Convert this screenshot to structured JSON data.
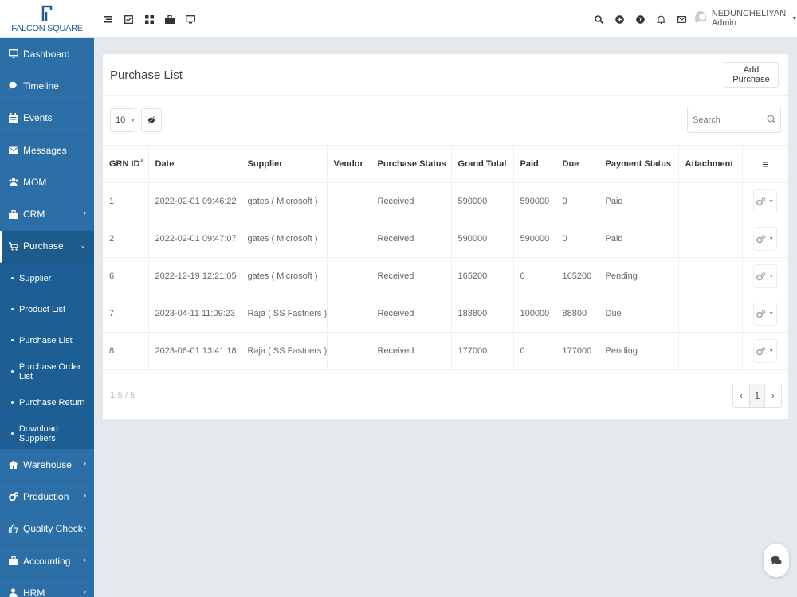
{
  "brand": {
    "logo_text": "FALCON SQUARE",
    "primary_color": "#2b6fa6",
    "logo_color": "#1f5f96"
  },
  "topbar": {
    "left_icons": [
      "list-icon",
      "checkbox-icon",
      "grid-icon",
      "briefcase-icon",
      "monitor-icon"
    ],
    "right_icons": [
      "search-icon",
      "plus-circle-icon",
      "globe-icon",
      "bell-icon",
      "mail-icon"
    ],
    "user": {
      "name": "NEDUNCHELIYAN Admin"
    }
  },
  "sidebar": {
    "items": [
      {
        "label": "Dashboard",
        "icon": "monitor-icon"
      },
      {
        "label": "Timeline",
        "icon": "comments-icon"
      },
      {
        "label": "Events",
        "icon": "calendar-icon"
      },
      {
        "label": "Messages",
        "icon": "envelope-icon"
      },
      {
        "label": "MOM",
        "icon": "users-icon"
      },
      {
        "label": "CRM",
        "icon": "briefcase-icon"
      },
      {
        "label": "Purchase",
        "icon": "cart-icon"
      },
      {
        "label": "Warehouse",
        "icon": "home-icon"
      },
      {
        "label": "Production",
        "icon": "cogs-icon"
      },
      {
        "label": "Quality Check",
        "icon": "thumbs-up-icon"
      },
      {
        "label": "Accounting",
        "icon": "briefcase-icon"
      },
      {
        "label": "HRM",
        "icon": "user-icon"
      }
    ],
    "purchase_submenu": [
      "Supplier",
      "Product List",
      "Purchase List",
      "Purchase Order List",
      "Purchase Return",
      "Download Suppliers"
    ]
  },
  "panel": {
    "title": "Purchase List",
    "add_button": "Add Purchase",
    "page_size": "10",
    "search_placeholder": "Search",
    "columns": [
      "GRN ID",
      "Date",
      "Supplier",
      "Vendor",
      "Purchase Status",
      "Grand Total",
      "Paid",
      "Due",
      "Payment Status",
      "Attachment",
      "≡"
    ],
    "rows": [
      [
        "1",
        "2022-02-01 09:46:22",
        "gates ( Microsoft )",
        "",
        "Received",
        "590000",
        "590000",
        "0",
        "Paid",
        ""
      ],
      [
        "2",
        "2022-02-01 09:47:07",
        "gates ( Microsoft )",
        "",
        "Received",
        "590000",
        "590000",
        "0",
        "Paid",
        ""
      ],
      [
        "6",
        "2022-12-19 12:21:05",
        "gates ( Microsoft )",
        "",
        "Received",
        "165200",
        "0",
        "165200",
        "Pending",
        ""
      ],
      [
        "7",
        "2023-04-11 11:09:23",
        "Raja ( SS Fastners )",
        "",
        "Received",
        "188800",
        "100000",
        "88800",
        "Due",
        ""
      ],
      [
        "8",
        "2023-06-01 13:41:18",
        "Raja ( SS Fastners )",
        "",
        "Received",
        "177000",
        "0",
        "177000",
        "Pending",
        ""
      ]
    ],
    "pagination_info": "1-5 / 5",
    "pagination": {
      "prev": "‹",
      "current": "1",
      "next": "›"
    }
  }
}
